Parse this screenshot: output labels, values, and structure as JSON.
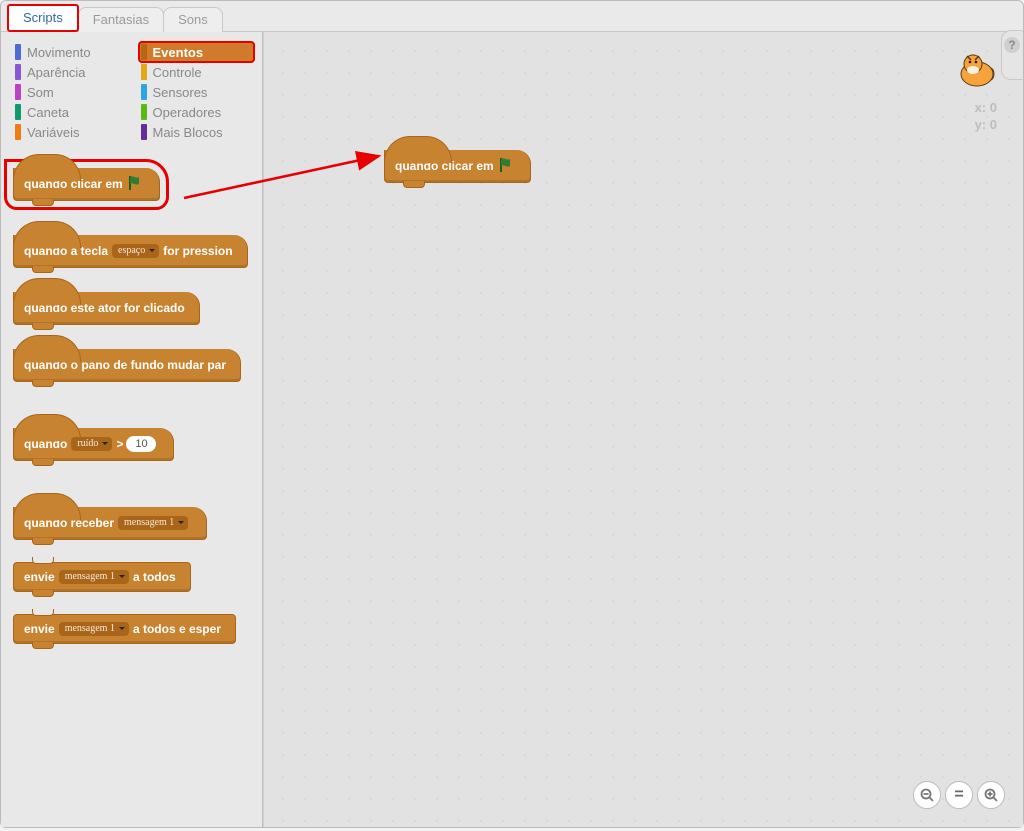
{
  "tabs": {
    "scripts": "Scripts",
    "costumes": "Fantasias",
    "sounds": "Sons"
  },
  "categories": {
    "left": [
      {
        "name": "Movimento",
        "color": "#4a6cd4"
      },
      {
        "name": "Aparência",
        "color": "#8a55d7"
      },
      {
        "name": "Som",
        "color": "#bb42c3"
      },
      {
        "name": "Caneta",
        "color": "#0e9a6c"
      },
      {
        "name": "Variáveis",
        "color": "#ee7d16"
      }
    ],
    "right": [
      {
        "name": "Eventos",
        "color": "#c88330"
      },
      {
        "name": "Controle",
        "color": "#e1a91a"
      },
      {
        "name": "Sensores",
        "color": "#2ca5e2"
      },
      {
        "name": "Operadores",
        "color": "#5cb712"
      },
      {
        "name": "Mais Blocos",
        "color": "#632d99"
      }
    ]
  },
  "blocks": {
    "whenFlagPrefix": "quando clicar em",
    "whenKey": {
      "pre": "quando a tecla",
      "key": "espaço",
      "post": "for pression"
    },
    "whenClicked": "quando este ator for clicado",
    "whenBackdrop": "quando o pano de fundo mudar par",
    "whenSensor": {
      "pre": "quando",
      "dd": "ruído",
      "op": ">",
      "val": "10"
    },
    "whenReceive": {
      "pre": "quando receber",
      "dd": "mensagem 1"
    },
    "broadcast": {
      "pre": "envie",
      "dd": "mensagem 1",
      "post": "a todos"
    },
    "broadcastWait": {
      "pre": "envie",
      "dd": "mensagem 1",
      "post": "a todos e esper"
    }
  },
  "coords": {
    "xLabel": "x:",
    "x": "0",
    "yLabel": "y:",
    "y": "0"
  },
  "zoom": {
    "out": "–",
    "reset": "=",
    "in": "+"
  },
  "help": "?"
}
